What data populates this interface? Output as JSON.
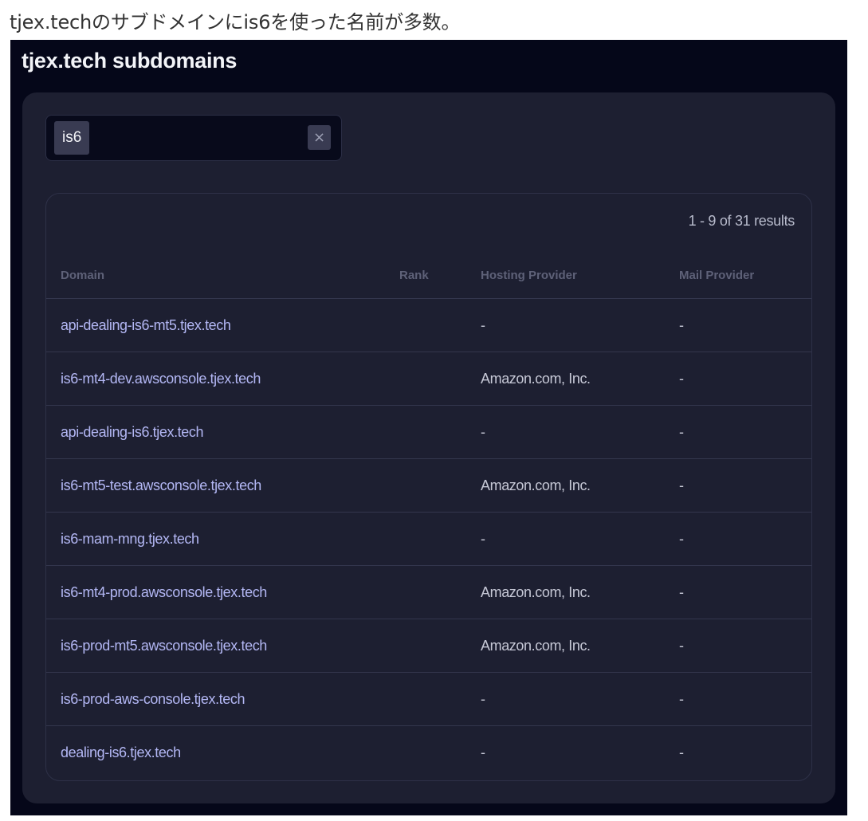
{
  "caption": "tjex.techのサブドメインにis6を使った名前が多数。",
  "page_title": "tjex.tech subdomains",
  "filter": {
    "chip_label": "is6",
    "clear_label": "×"
  },
  "results_text": "1 - 9 of 31 results",
  "columns": {
    "domain": "Domain",
    "rank": "Rank",
    "hosting": "Hosting Provider",
    "mail": "Mail Provider"
  },
  "rows": [
    {
      "domain": "api-dealing-is6-mt5.tjex.tech",
      "rank": "",
      "hosting": "-",
      "mail": "-"
    },
    {
      "domain": "is6-mt4-dev.awsconsole.tjex.tech",
      "rank": "",
      "hosting": "Amazon.com, Inc.",
      "mail": "-"
    },
    {
      "domain": "api-dealing-is6.tjex.tech",
      "rank": "",
      "hosting": "-",
      "mail": "-"
    },
    {
      "domain": "is6-mt5-test.awsconsole.tjex.tech",
      "rank": "",
      "hosting": "Amazon.com, Inc.",
      "mail": "-"
    },
    {
      "domain": "is6-mam-mng.tjex.tech",
      "rank": "",
      "hosting": "-",
      "mail": "-"
    },
    {
      "domain": "is6-mt4-prod.awsconsole.tjex.tech",
      "rank": "",
      "hosting": "Amazon.com, Inc.",
      "mail": "-"
    },
    {
      "domain": "is6-prod-mt5.awsconsole.tjex.tech",
      "rank": "",
      "hosting": "Amazon.com, Inc.",
      "mail": "-"
    },
    {
      "domain": "is6-prod-aws-console.tjex.tech",
      "rank": "",
      "hosting": "-",
      "mail": "-"
    },
    {
      "domain": "dealing-is6.tjex.tech",
      "rank": "",
      "hosting": "-",
      "mail": "-"
    }
  ],
  "colors": {
    "background": "#050719",
    "panel": "#1d1f31",
    "link": "#b3b7f4"
  }
}
